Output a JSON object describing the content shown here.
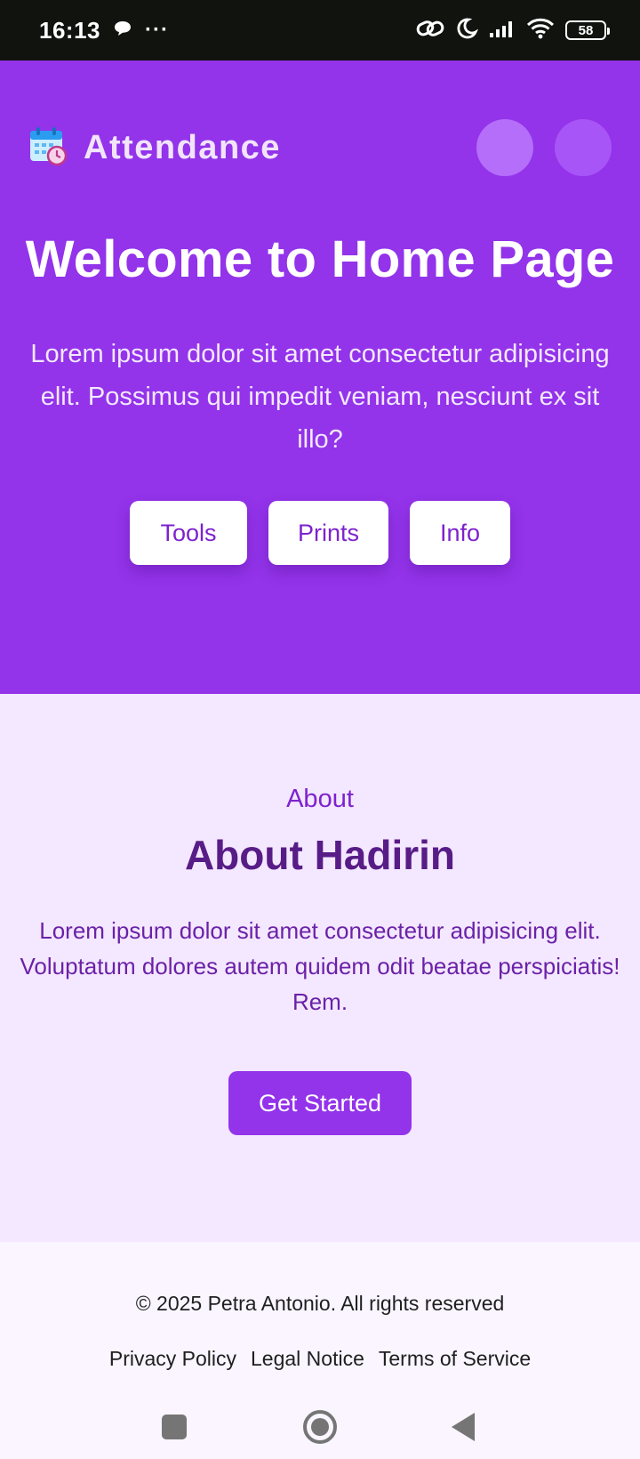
{
  "status_bar": {
    "time": "16:13",
    "more": "···",
    "battery": "58",
    "icons": [
      "chat-bubble-icon",
      "link-icon",
      "moon-icon",
      "signal-icon",
      "wifi-icon",
      "battery-icon"
    ]
  },
  "header": {
    "app_title": "Attendance",
    "logo_icon": "calendar-clock-icon"
  },
  "hero": {
    "title": "Welcome to Home Page",
    "text": "Lorem ipsum dolor sit amet consectetur adipisicing elit. Possimus qui impedit veniam, nesciunt ex sit illo?",
    "buttons": [
      "Tools",
      "Prints",
      "Info"
    ]
  },
  "about": {
    "kicker": "About",
    "title": "About Hadirin",
    "text": "Lorem ipsum dolor sit amet consectetur adipisicing elit. Voluptatum dolores autem quidem odit beatae perspiciatis! Rem.",
    "cta": "Get Started"
  },
  "footer": {
    "copyright": "© 2025 Petra Antonio. All rights reserved",
    "links": [
      "Privacy Policy",
      "Legal Notice",
      "Terms of Service"
    ]
  },
  "nav_bar": {
    "icons": [
      "recents-icon",
      "home-icon",
      "back-icon"
    ]
  },
  "colors": {
    "primary": "#9333ea",
    "about_bg": "#f3e8ff",
    "footer_bg": "#faf5ff",
    "dark_purple": "#581c87"
  }
}
